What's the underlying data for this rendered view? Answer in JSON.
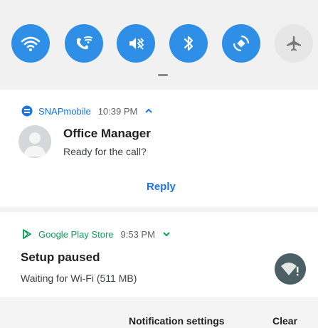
{
  "quick_settings": {
    "tiles": [
      {
        "icon": "wifi-icon",
        "active": true
      },
      {
        "icon": "wifi-calling-icon",
        "active": true
      },
      {
        "icon": "vibrate-icon",
        "active": true
      },
      {
        "icon": "bluetooth-icon",
        "active": true
      },
      {
        "icon": "auto-rotate-icon",
        "active": true
      },
      {
        "icon": "airplane-mode-icon",
        "active": false
      }
    ],
    "active_color": "#2f8fe6"
  },
  "notifications": [
    {
      "app": "SNAPmobile",
      "time": "10:39 PM",
      "title": "Office Manager",
      "text": "Ready for the call?",
      "action": "Reply"
    },
    {
      "app": "Google Play Store",
      "time": "9:53 PM",
      "title": "Setup paused",
      "text": "Waiting for Wi-Fi (511 MB)"
    }
  ],
  "footer": {
    "settings_label": "Notification settings",
    "clear_label": "Clear"
  }
}
